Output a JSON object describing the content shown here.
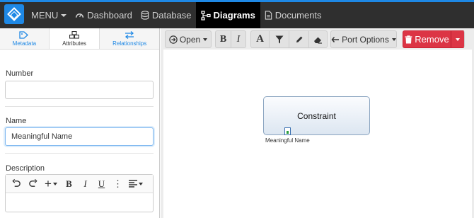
{
  "nav": {
    "menu_label": "MENU",
    "items": [
      {
        "label": "Dashboard"
      },
      {
        "label": "Database"
      },
      {
        "label": "Diagrams"
      },
      {
        "label": "Documents"
      }
    ],
    "accent": "#1e88e5"
  },
  "left_panel": {
    "tabs": [
      {
        "label": "Metadata"
      },
      {
        "label": "Attributes"
      },
      {
        "label": "Relationships"
      }
    ],
    "number": {
      "label": "Number",
      "value": ""
    },
    "name": {
      "label": "Name",
      "value": "Meaningful Name"
    },
    "description": {
      "label": "Description",
      "value": ""
    },
    "editor_buttons": {
      "undo": "undo-icon",
      "redo": "redo-icon",
      "insert": "+",
      "bold": "B",
      "italic": "I",
      "underline": "U",
      "more": "⋮",
      "align": "align-icon"
    }
  },
  "toolbar": {
    "open_label": "Open",
    "bold_label": "B",
    "italic_label": "I",
    "font_label": "A",
    "port_options_label": "Port Options",
    "remove_label": "Remove",
    "remove_color": "#dc3545"
  },
  "diagram": {
    "node_title": "Constraint",
    "node_caption": "Meaningful Name"
  }
}
